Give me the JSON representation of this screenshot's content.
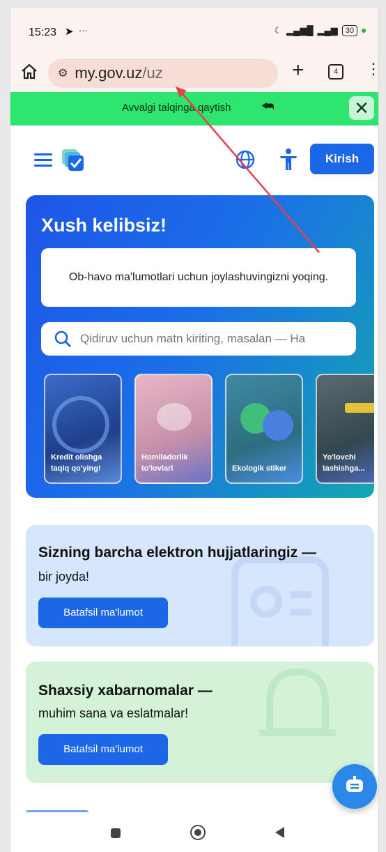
{
  "status_bar": {
    "time": "15:23",
    "extras": "···",
    "battery": "30"
  },
  "browser": {
    "url_domain": "my.gov.uz",
    "url_path": "/uz",
    "tab_count": "4"
  },
  "banner": {
    "text": "Avvalgi talqinga qaytish",
    "back_symbol": "⮪",
    "close_symbol": "✕"
  },
  "header": {
    "login_label": "Kirish"
  },
  "hero": {
    "title": "Xush kelibsiz!",
    "weather_text": "Ob-havo ma'lumotlari uchun joylashuvingizni yoqing.",
    "search_placeholder": "Qidiruv uchun matn kiriting, masalan — Ha",
    "cards": [
      {
        "line1": "Kredit olishga",
        "line2": "taqiq qo'ying!"
      },
      {
        "line1": "Homiladorlik",
        "line2": "to'lovlari"
      },
      {
        "line1": "Ekologik stiker",
        "line2": ""
      },
      {
        "line1": "Yo'lovchi",
        "line2": "tashishga..."
      }
    ]
  },
  "documents": {
    "title": "Sizning barcha elektron hujjatlaringiz —",
    "subtitle": "bir joyda!",
    "button": "Batafsil ma'lumot"
  },
  "notifications": {
    "title": "Shaxsiy xabarnomalar —",
    "subtitle": "muhim sana va eslatmalar!",
    "button": "Batafsil ma'lumot"
  },
  "colors": {
    "accent": "#1b67e8",
    "banner": "#2ee66f",
    "annotation_arrow": "#e8414e"
  }
}
